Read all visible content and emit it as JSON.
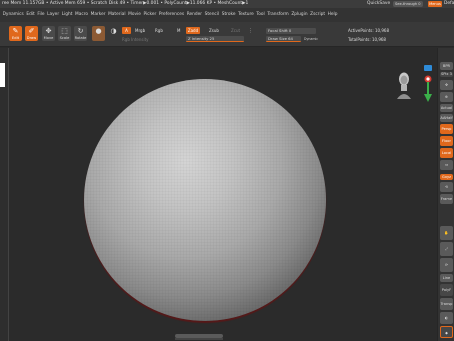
{
  "titlebar": {
    "info": "ree Mem 11.157GB • Active Mem 659 • Scratch Disk 49 • Timer▶0.001 • PolyCount▶11.066 KP • MeshCount▶1",
    "quicksave": "QuickSave",
    "see_through": "See-through 0",
    "menus": "Menus",
    "default": "Defa"
  },
  "menu": [
    "Dynamics",
    "Edit",
    "File",
    "Layer",
    "Light",
    "Macro",
    "Marker",
    "Material",
    "Movie",
    "Picker",
    "Preferences",
    "Render",
    "Stencil",
    "Stroke",
    "Texture",
    "Tool",
    "Transform",
    "Zplugin",
    "Zscript",
    "Help"
  ],
  "toolbar": {
    "edit": "Edit",
    "draw": "Draw",
    "move": "Move",
    "scale": "Scale",
    "rotate": "Rotate",
    "a": "A",
    "mrgb": "Mrgb",
    "rgb": "Rgb",
    "m": "M",
    "rgb_intensity": "Rgb Intensity",
    "zadd": "Zadd",
    "zsub": "Zsub",
    "zcut": "Zcut",
    "z_intensity": "Z Intensity 25",
    "focal_shift": "Focal Shift 0",
    "draw_size": "Draw Size 64",
    "dynamic": "Dynamic",
    "active_points": "ActivePoints: 10,968",
    "total_points": "TotalPoints: 10,968"
  },
  "right_panel": {
    "bpr": "BPR",
    "spix": "SPix 3",
    "scroll": "Scroll",
    "zoom": "Zoom",
    "actual": "Actual",
    "aahalf": "AAHalf",
    "persp": "Persp",
    "floor": "Floor",
    "local": "Local",
    "gxyz": "Gxyz",
    "frame": "Frame",
    "move": "Move",
    "scale": "Scale",
    "rotate": "Rotate",
    "linefill": "Line Fill",
    "polyf": "PolyF",
    "transp": "Transp"
  },
  "colors": {
    "accent": "#e0681c",
    "background": "#2b2b2b",
    "panel": "#393939"
  }
}
